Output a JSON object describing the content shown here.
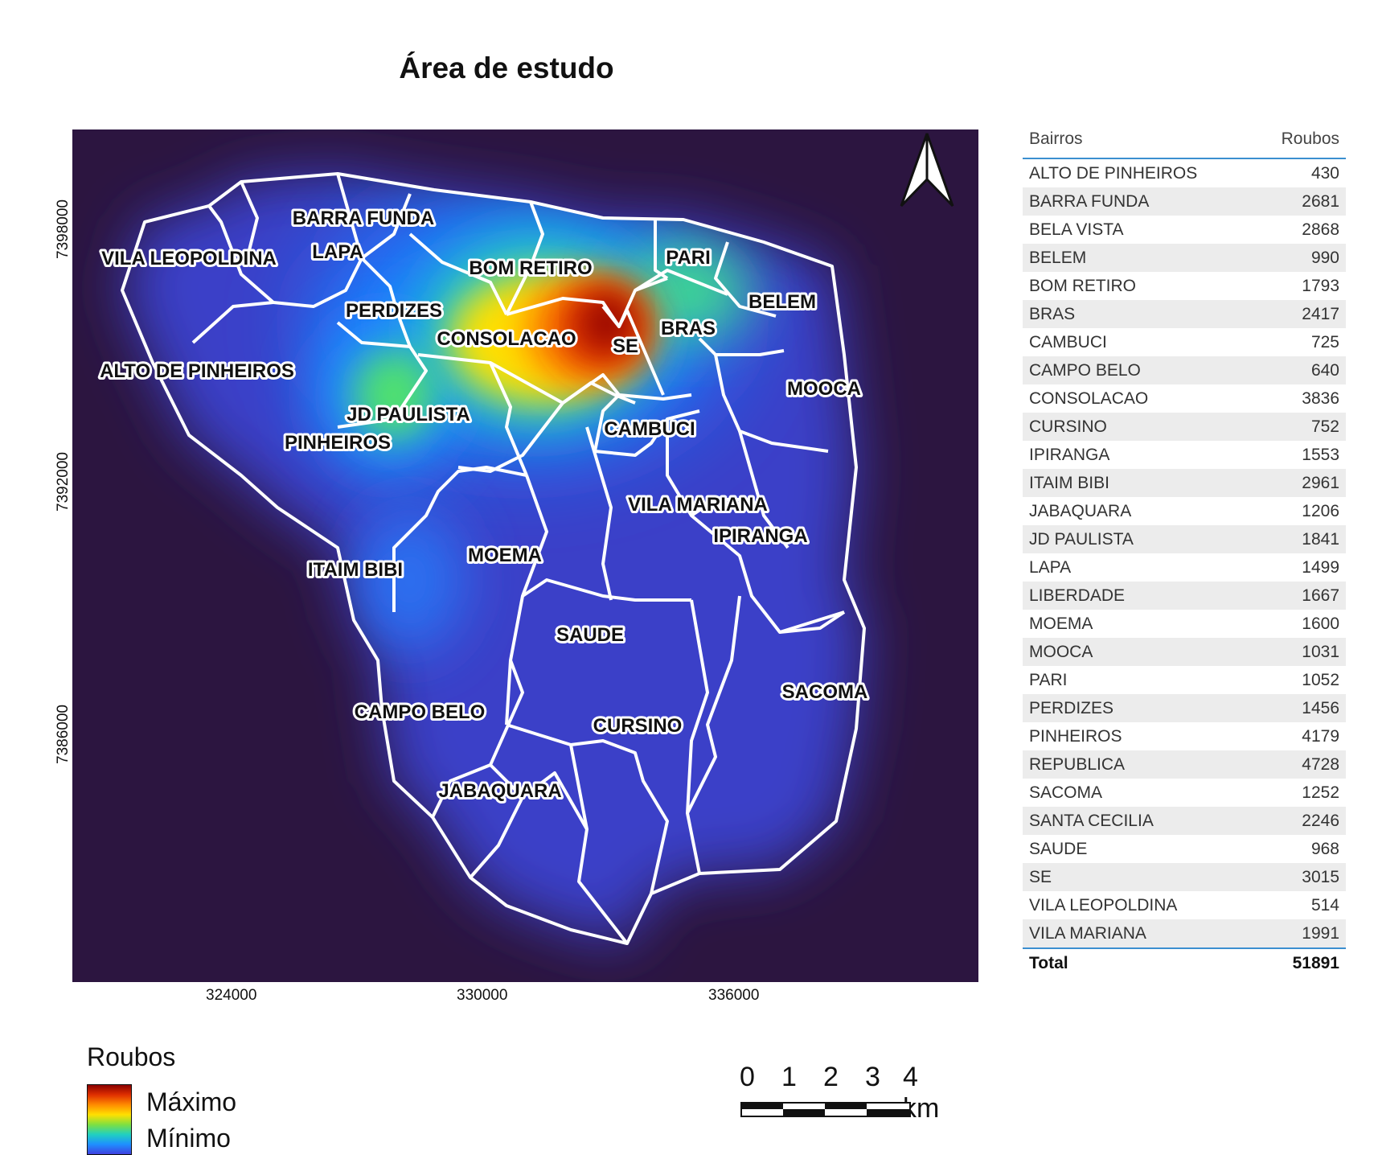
{
  "map": {
    "title": "Área de estudo",
    "x_ticks": [
      "324000",
      "330000",
      "336000"
    ],
    "y_ticks": [
      "7398000",
      "7392000",
      "7386000"
    ],
    "north_arrow_icon": "north-arrow-icon",
    "neighborhood_labels": [
      "BARRA FUNDA",
      "LAPA",
      "VILA LEOPOLDINA",
      "BOM RETIRO",
      "PARI",
      "PERDIZES",
      "BELEM",
      "CONSOLACAO",
      "SE",
      "BRAS",
      "ALTO DE PINHEIROS",
      "MOOCA",
      "JD PAULISTA",
      "PINHEIROS",
      "CAMBUCI",
      "VILA MARIANA",
      "IPIRANGA",
      "ITAIM BIBI",
      "MOEMA",
      "SAUDE",
      "SACOMA",
      "CAMPO BELO",
      "CURSINO",
      "JABAQUARA"
    ],
    "colors": {
      "background": "#2c1540",
      "low": "#4040e0",
      "mid": "#20d0c0",
      "high": "#e03000",
      "max": "#8b0000",
      "boundary": "#ffffff"
    }
  },
  "legend": {
    "title": "Roubos",
    "max_label": "Máximo",
    "min_label": "Mínimo"
  },
  "scale": {
    "labels": [
      "0",
      "1",
      "2",
      "3",
      "4 km"
    ]
  },
  "table": {
    "col_bairros": "Bairros",
    "col_roubos": "Roubos",
    "rows": [
      {
        "bairro": "ALTO DE PINHEIROS",
        "roubos": "430"
      },
      {
        "bairro": "BARRA FUNDA",
        "roubos": "2681"
      },
      {
        "bairro": "BELA VISTA",
        "roubos": "2868"
      },
      {
        "bairro": "BELEM",
        "roubos": "990"
      },
      {
        "bairro": "BOM RETIRO",
        "roubos": "1793"
      },
      {
        "bairro": "BRAS",
        "roubos": "2417"
      },
      {
        "bairro": "CAMBUCI",
        "roubos": "725"
      },
      {
        "bairro": "CAMPO BELO",
        "roubos": "640"
      },
      {
        "bairro": "CONSOLACAO",
        "roubos": "3836"
      },
      {
        "bairro": "CURSINO",
        "roubos": "752"
      },
      {
        "bairro": "IPIRANGA",
        "roubos": "1553"
      },
      {
        "bairro": "ITAIM BIBI",
        "roubos": "2961"
      },
      {
        "bairro": "JABAQUARA",
        "roubos": "1206"
      },
      {
        "bairro": "JD PAULISTA",
        "roubos": "1841"
      },
      {
        "bairro": "LAPA",
        "roubos": "1499"
      },
      {
        "bairro": "LIBERDADE",
        "roubos": "1667"
      },
      {
        "bairro": "MOEMA",
        "roubos": "1600"
      },
      {
        "bairro": "MOOCA",
        "roubos": "1031"
      },
      {
        "bairro": "PARI",
        "roubos": "1052"
      },
      {
        "bairro": "PERDIZES",
        "roubos": "1456"
      },
      {
        "bairro": "PINHEIROS",
        "roubos": "4179"
      },
      {
        "bairro": "REPUBLICA",
        "roubos": "4728"
      },
      {
        "bairro": "SACOMA",
        "roubos": "1252"
      },
      {
        "bairro": "SANTA CECILIA",
        "roubos": "2246"
      },
      {
        "bairro": "SAUDE",
        "roubos": "968"
      },
      {
        "bairro": "SE",
        "roubos": "3015"
      },
      {
        "bairro": "VILA LEOPOLDINA",
        "roubos": "514"
      },
      {
        "bairro": "VILA MARIANA",
        "roubos": "1991"
      }
    ],
    "total_label": "Total",
    "total_value": "51891"
  }
}
